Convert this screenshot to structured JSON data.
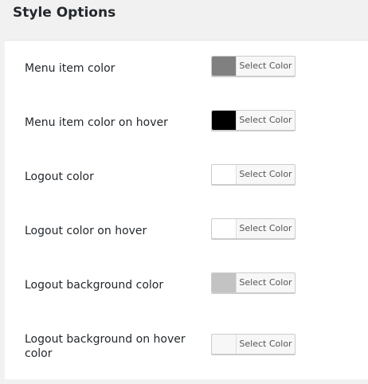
{
  "section": {
    "title": "Style Options"
  },
  "picker_label": "Select Color",
  "options": [
    {
      "label": "Menu item color",
      "swatch": "#808080"
    },
    {
      "label": "Menu item color on hover",
      "swatch": "#000000"
    },
    {
      "label": "Logout color",
      "swatch": "#ffffff"
    },
    {
      "label": "Logout color on hover",
      "swatch": "#ffffff"
    },
    {
      "label": "Logout background color",
      "swatch": "#c3c3c3"
    },
    {
      "label": "Logout background on hover color",
      "swatch": "#f7f7f7"
    }
  ]
}
